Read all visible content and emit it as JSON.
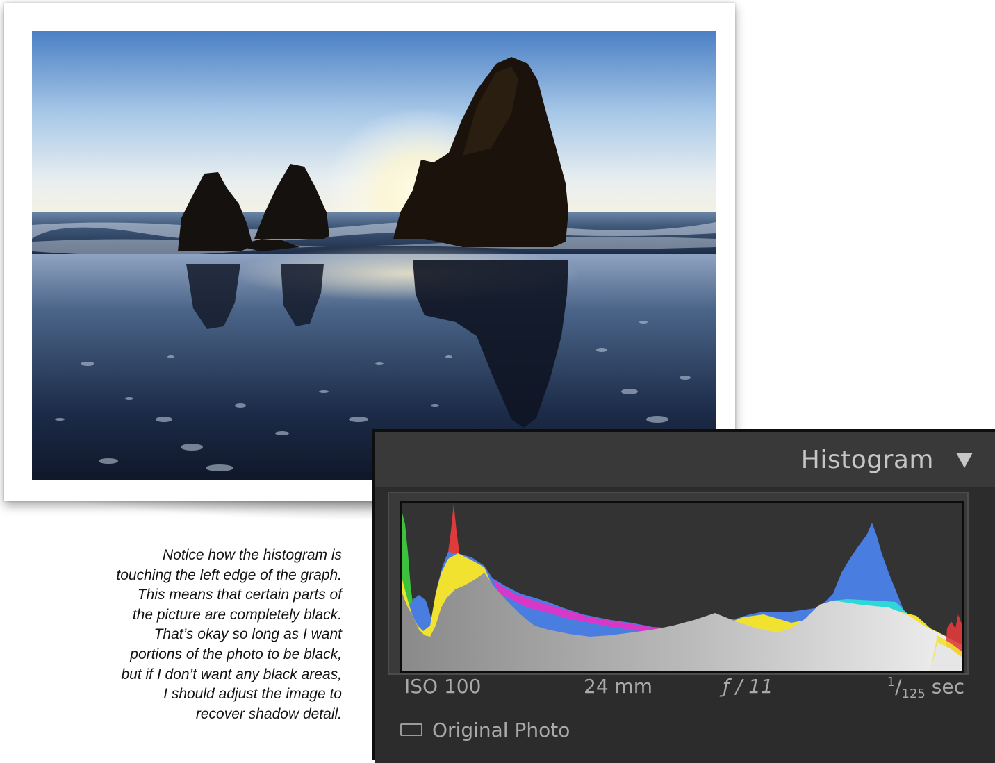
{
  "caption": {
    "lines": [
      "Notice how the histogram is",
      "touching the left edge of the graph.",
      "This means that certain parts of",
      "the picture are completely black.",
      "That’s okay so long as I want",
      "portions of the photo to be black,",
      "but if I don’t want any black areas,",
      "I should adjust the image to",
      "recover shadow detail."
    ]
  },
  "histogram_panel": {
    "title": "Histogram",
    "toggle_icon": "triangle-down-icon",
    "meta": {
      "iso": "ISO 100",
      "focal_length": "24 mm",
      "aperture": "ƒ / 11",
      "shutter_num": "1",
      "shutter_den": "125",
      "shutter_unit": "sec"
    },
    "original_photo_label": "Original Photo",
    "original_photo_checked": false
  },
  "colors": {
    "panel_bg": "#2c2c2c",
    "header_bg": "#393939",
    "text": "#c6c6c6",
    "hist_blue": "#4a7de0",
    "hist_yellow": "#f2e230",
    "hist_red": "#e03a3a",
    "hist_cyan": "#2fd8d8",
    "hist_magenta": "#d838c8",
    "hist_green": "#3cc23c"
  }
}
